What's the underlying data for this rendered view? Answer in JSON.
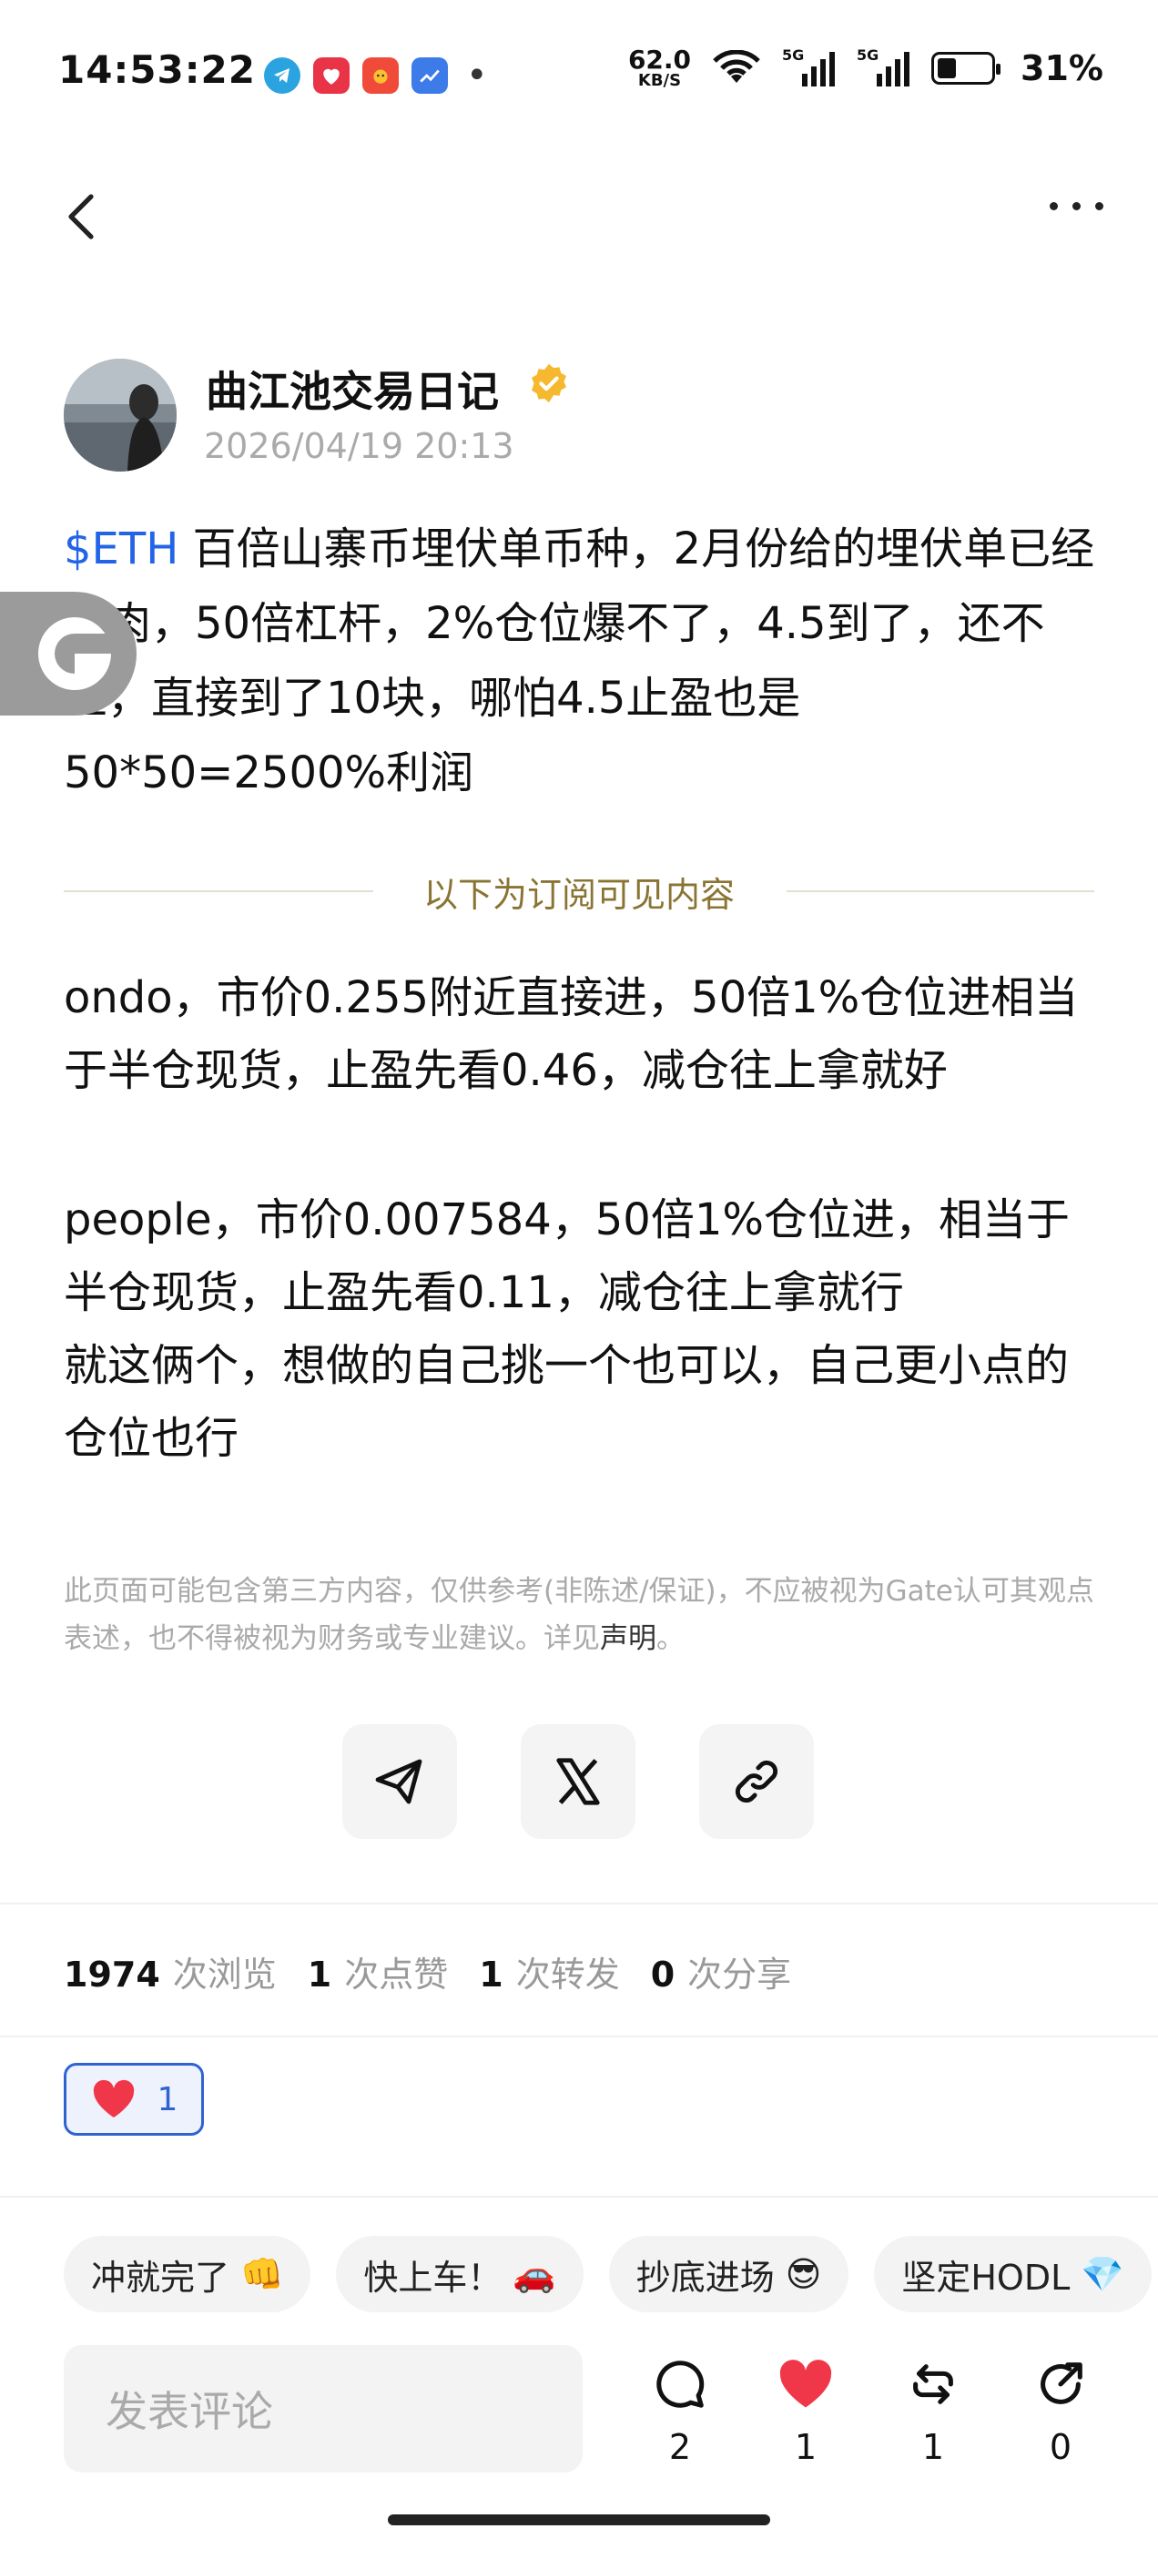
{
  "status_bar": {
    "time": "14:53:22",
    "net_speed_value": "62.0",
    "net_speed_unit": "KB/S",
    "signal_label_1": "5G",
    "signal_label_2": "5G",
    "battery": "31%",
    "app_icons": [
      "telegram-icon",
      "heart-app-icon",
      "pet-app-icon",
      "chart-app-icon"
    ],
    "notification_dot": "•"
  },
  "post": {
    "author": "曲江池交易日记",
    "date": "2026/04/19 20:13",
    "tag": "$ETH",
    "text": " 百倍山寨币埋伏单币种，2月份给的埋伏单已经吃肉，50倍杠杆，2%仓位爆不了，4.5到了，还不止，直接到了10块，哪怕4.5止盈也是50*50=2500%利润",
    "divider": "以下为订阅可见内容",
    "sub_p1": "ondo，市价0.255附近直接进，50倍1%仓位进相当于半仓现货，止盈先看0.46，减仓往上拿就好",
    "sub_p2": "people，市价0.007584，50倍1%仓位进，相当于半仓现货，止盈先看0.11，减仓往上拿就行",
    "sub_p3": "就这俩个，想做的自己挑一个也可以，自己更小点的仓位也行",
    "disclaimer": "此页面可能包含第三方内容，仅供参考(非陈述/保证)，不应被视为Gate认可其观点表述，也不得被视为财务或专业建议。详见",
    "disclaimer_link": "声明",
    "disclaimer_end": "。"
  },
  "stats": {
    "views": "1974",
    "views_label": "次浏览",
    "likes": "1",
    "likes_label": "次点赞",
    "reposts": "1",
    "reposts_label": "次转发",
    "shares": "0",
    "shares_label": "次分享"
  },
  "reaction": {
    "count": "1"
  },
  "quick_replies": [
    {
      "text": "冲就完了",
      "emoji": "👊"
    },
    {
      "text": "快上车！",
      "emoji": "🚗"
    },
    {
      "text": "抄底进场",
      "emoji": "😎"
    },
    {
      "text": "坚定HODL",
      "emoji": "💎"
    }
  ],
  "bottom_bar": {
    "comment_placeholder": "发表评论",
    "comments": "2",
    "likes": "1",
    "reposts": "1",
    "shares": "0"
  },
  "colors": {
    "accent": "#2364e6",
    "like_red": "#f0374a",
    "divider_gold": "#8a7433"
  }
}
